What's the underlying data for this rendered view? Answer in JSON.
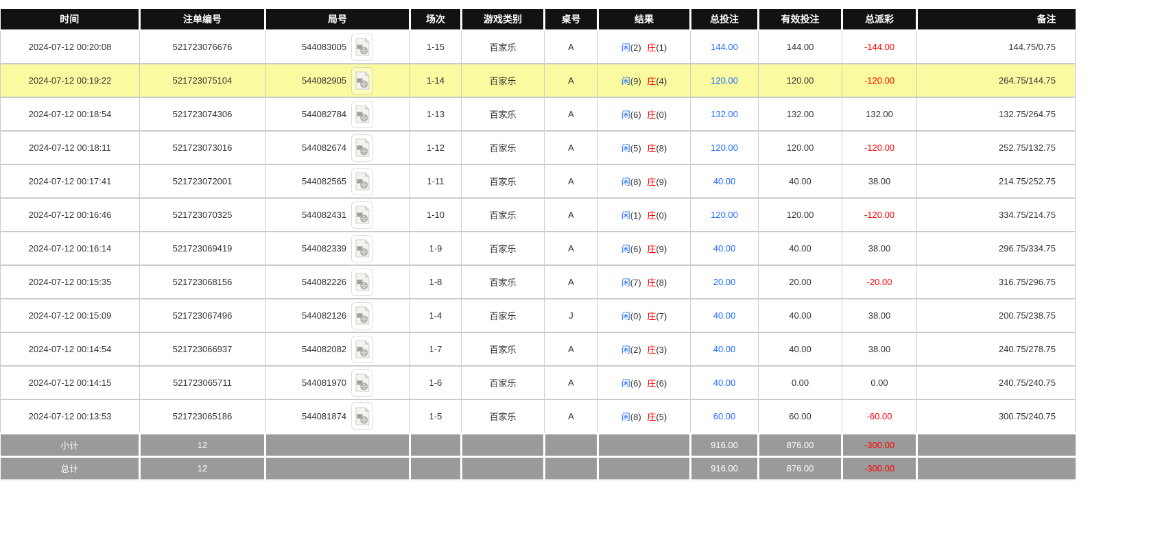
{
  "colors": {
    "header_bg": "#121212",
    "footer_bg": "#9a9a9a",
    "highlight_yellow": "#fafaa0",
    "player_blue": "#1f6bff",
    "banker_red": "#ff0000",
    "bet_amount_blue": "#1f6bff",
    "negative_red": "#ff0000"
  },
  "icons": {
    "round_video": "video-file-icon"
  },
  "table": {
    "columns": [
      {
        "key": "time",
        "label": "时间"
      },
      {
        "key": "order_no",
        "label": "注单编号"
      },
      {
        "key": "round_no",
        "label": "局号"
      },
      {
        "key": "session",
        "label": "场次"
      },
      {
        "key": "game_type",
        "label": "游戏类别"
      },
      {
        "key": "table_no",
        "label": "桌号"
      },
      {
        "key": "result",
        "label": "结果"
      },
      {
        "key": "total_bet",
        "label": "总投注"
      },
      {
        "key": "valid_bet",
        "label": "有效投注"
      },
      {
        "key": "total_payout",
        "label": "总派彩"
      },
      {
        "key": "remark",
        "label": "备注"
      }
    ],
    "result_labels": {
      "player": "闲",
      "banker": "庄"
    },
    "rows": [
      {
        "time": "2024-07-12 00:20:08",
        "order_no": "521723076676",
        "round_no": "544083005",
        "session": "1-15",
        "game_type": "百家乐",
        "table_no": "A",
        "result": {
          "player": 2,
          "banker": 1
        },
        "total_bet": "144.00",
        "valid_bet": "144.00",
        "total_payout": "-144.00",
        "remark": "144.75/0.75",
        "highlighted": false
      },
      {
        "time": "2024-07-12 00:19:22",
        "order_no": "521723075104",
        "round_no": "544082905",
        "session": "1-14",
        "game_type": "百家乐",
        "table_no": "A",
        "result": {
          "player": 9,
          "banker": 4
        },
        "total_bet": "120.00",
        "valid_bet": "120.00",
        "total_payout": "-120.00",
        "remark": "264.75/144.75",
        "highlighted": true
      },
      {
        "time": "2024-07-12 00:18:54",
        "order_no": "521723074306",
        "round_no": "544082784",
        "session": "1-13",
        "game_type": "百家乐",
        "table_no": "A",
        "result": {
          "player": 6,
          "banker": 0
        },
        "total_bet": "132.00",
        "valid_bet": "132.00",
        "total_payout": "132.00",
        "remark": "132.75/264.75",
        "highlighted": false
      },
      {
        "time": "2024-07-12 00:18:11",
        "order_no": "521723073016",
        "round_no": "544082674",
        "session": "1-12",
        "game_type": "百家乐",
        "table_no": "A",
        "result": {
          "player": 5,
          "banker": 8
        },
        "total_bet": "120.00",
        "valid_bet": "120.00",
        "total_payout": "-120.00",
        "remark": "252.75/132.75",
        "highlighted": false
      },
      {
        "time": "2024-07-12 00:17:41",
        "order_no": "521723072001",
        "round_no": "544082565",
        "session": "1-11",
        "game_type": "百家乐",
        "table_no": "A",
        "result": {
          "player": 8,
          "banker": 9
        },
        "total_bet": "40.00",
        "valid_bet": "40.00",
        "total_payout": "38.00",
        "remark": "214.75/252.75",
        "highlighted": false
      },
      {
        "time": "2024-07-12 00:16:46",
        "order_no": "521723070325",
        "round_no": "544082431",
        "session": "1-10",
        "game_type": "百家乐",
        "table_no": "A",
        "result": {
          "player": 1,
          "banker": 0
        },
        "total_bet": "120.00",
        "valid_bet": "120.00",
        "total_payout": "-120.00",
        "remark": "334.75/214.75",
        "highlighted": false
      },
      {
        "time": "2024-07-12 00:16:14",
        "order_no": "521723069419",
        "round_no": "544082339",
        "session": "1-9",
        "game_type": "百家乐",
        "table_no": "A",
        "result": {
          "player": 6,
          "banker": 9
        },
        "total_bet": "40.00",
        "valid_bet": "40.00",
        "total_payout": "38.00",
        "remark": "296.75/334.75",
        "highlighted": false
      },
      {
        "time": "2024-07-12 00:15:35",
        "order_no": "521723068156",
        "round_no": "544082226",
        "session": "1-8",
        "game_type": "百家乐",
        "table_no": "A",
        "result": {
          "player": 7,
          "banker": 8
        },
        "total_bet": "20.00",
        "valid_bet": "20.00",
        "total_payout": "-20.00",
        "remark": "316.75/296.75",
        "highlighted": false
      },
      {
        "time": "2024-07-12 00:15:09",
        "order_no": "521723067496",
        "round_no": "544082126",
        "session": "1-4",
        "game_type": "百家乐",
        "table_no": "J",
        "result": {
          "player": 0,
          "banker": 7
        },
        "total_bet": "40.00",
        "valid_bet": "40.00",
        "total_payout": "38.00",
        "remark": "200.75/238.75",
        "highlighted": false
      },
      {
        "time": "2024-07-12 00:14:54",
        "order_no": "521723066937",
        "round_no": "544082082",
        "session": "1-7",
        "game_type": "百家乐",
        "table_no": "A",
        "result": {
          "player": 2,
          "banker": 3
        },
        "total_bet": "40.00",
        "valid_bet": "40.00",
        "total_payout": "38.00",
        "remark": "240.75/278.75",
        "highlighted": false
      },
      {
        "time": "2024-07-12 00:14:15",
        "order_no": "521723065711",
        "round_no": "544081970",
        "session": "1-6",
        "game_type": "百家乐",
        "table_no": "A",
        "result": {
          "player": 6,
          "banker": 6
        },
        "total_bet": "40.00",
        "valid_bet": "0.00",
        "total_payout": "0.00",
        "remark": "240.75/240.75",
        "highlighted": false
      },
      {
        "time": "2024-07-12 00:13:53",
        "order_no": "521723065186",
        "round_no": "544081874",
        "session": "1-5",
        "game_type": "百家乐",
        "table_no": "A",
        "result": {
          "player": 8,
          "banker": 5
        },
        "total_bet": "60.00",
        "valid_bet": "60.00",
        "total_payout": "-60.00",
        "remark": "300.75/240.75",
        "highlighted": false
      }
    ],
    "footer": [
      {
        "label": "小计",
        "count": "12",
        "total_bet": "916.00",
        "valid_bet": "876.00",
        "total_payout": "-300.00"
      },
      {
        "label": "总计",
        "count": "12",
        "total_bet": "916.00",
        "valid_bet": "876.00",
        "total_payout": "-300.00"
      }
    ]
  }
}
